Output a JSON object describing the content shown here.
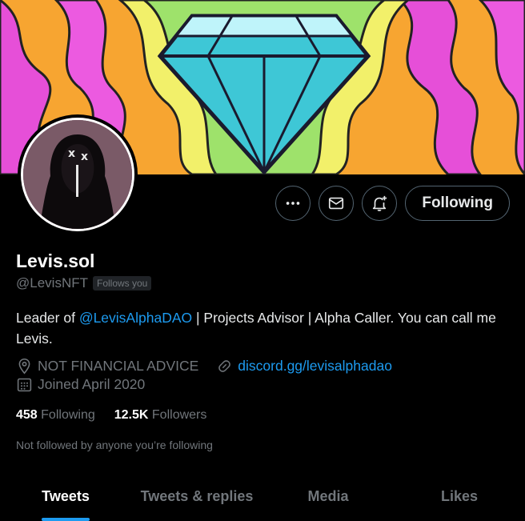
{
  "profile": {
    "display_name": "Levis.sol",
    "handle": "@LevisNFT",
    "follows_you": "Follows you",
    "bio_prefix": "Leader of ",
    "bio_mention": "@LevisAlphaDAO",
    "bio_suffix": " | Projects Advisor | Alpha Caller. You can call me Levis.",
    "location": "NOT FINANCIAL ADVICE",
    "website": "discord.gg/levisalphadao",
    "joined": "Joined April 2020"
  },
  "stats": {
    "following_count": "458",
    "following_label": "Following",
    "followers_count": "12.5K",
    "followers_label": "Followers"
  },
  "not_followed_text": "Not followed by anyone you’re following",
  "actions": {
    "follow_label": "Following"
  },
  "tabs": [
    {
      "label": "Tweets",
      "active": true
    },
    {
      "label": "Tweets & replies",
      "active": false
    },
    {
      "label": "Media",
      "active": false
    },
    {
      "label": "Likes",
      "active": false
    }
  ],
  "colors": {
    "background": "#000000",
    "accent": "#1d9bf0",
    "muted": "#71767b"
  }
}
